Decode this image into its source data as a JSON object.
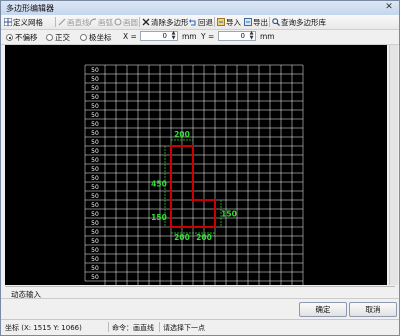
{
  "window": {
    "title": "多边形编辑器",
    "close_glyph": "✕"
  },
  "toolbar": {
    "define_grid": "定义网格",
    "draw_line": "画直线",
    "draw_arc": "画弧",
    "draw_circle": "画圆",
    "clear_polygon": "清除多边形",
    "undo": "回退",
    "import": "导入",
    "export": "导出",
    "query_library": "查询多边形库"
  },
  "coordbar": {
    "opt_none": "不偏移",
    "opt_ortho": "正交",
    "opt_polar": "极坐标",
    "x_label": "X =",
    "x_value": "0",
    "x_unit": "mm",
    "y_label": "Y =",
    "y_value": "0",
    "y_unit": "mm",
    "selected": "不偏移"
  },
  "grid": {
    "row_labels": [
      "50",
      "50",
      "50",
      "50",
      "50",
      "50",
      "50",
      "50",
      "50",
      "50",
      "50",
      "50",
      "50",
      "50",
      "50",
      "50",
      "50",
      "50",
      "50",
      "50",
      "50",
      "50",
      "50",
      "50"
    ],
    "col_labels": [
      "100",
      "100",
      "100",
      "100",
      "100",
      "100",
      "100",
      "100",
      "100",
      "100",
      "100",
      "100",
      "100",
      "100",
      "100",
      "100",
      "100",
      "100"
    ]
  },
  "shape": {
    "dim_top": "200",
    "dim_left": "450",
    "dim_bottom_left": "150",
    "dim_right": "150",
    "dim_bottom_a": "200",
    "dim_bottom_b": "200"
  },
  "colors": {
    "canvas": "#000000",
    "grid": "#ffffff",
    "polygon": "#cc0000",
    "dimension": "#33dd33"
  },
  "dynamic_input": "动态输入",
  "buttons": {
    "ok": "确定",
    "cancel": "取消"
  },
  "status": {
    "coord": "坐标 (X: 1515 Y: 1066)",
    "command": "命令：画直线",
    "prompt": "请选择下一点"
  }
}
